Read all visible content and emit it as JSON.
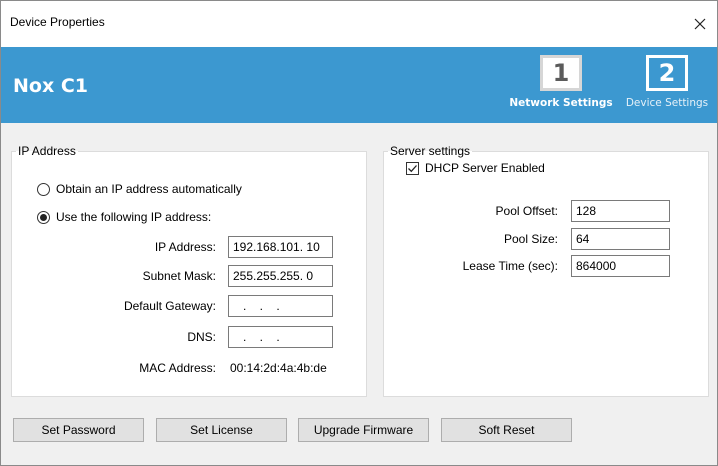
{
  "window": {
    "title": "Device Properties",
    "close_glyph": "×",
    "close_icon": "close-icon"
  },
  "banner": {
    "device_name": "Nox C1",
    "steps": [
      {
        "number": "1",
        "label": "Network Settings",
        "active": true
      },
      {
        "number": "2",
        "label": "Device Settings",
        "active": false
      }
    ],
    "colors": {
      "background": "#3c98d0",
      "text": "#ffffff"
    }
  },
  "ip_address": {
    "group_label": "IP Address",
    "radio_auto_label": "Obtain an IP address automatically",
    "radio_manual_label": "Use the following IP address:",
    "selected_option": "manual",
    "fields": {
      "ip_label": "IP Address:",
      "ip_value": "192.168.101. 10",
      "subnet_label": "Subnet Mask:",
      "subnet_value": "255.255.255. 0",
      "gateway_label": "Default Gateway:",
      "gateway_value": "   .    .    .",
      "dns_label": "DNS:",
      "dns_value": "   .    .    .",
      "mac_label": "MAC Address:",
      "mac_value": "00:14:2d:4a:4b:de"
    }
  },
  "server": {
    "group_label": "Server settings",
    "dhcp_label": "DHCP Server Enabled",
    "dhcp_checked": true,
    "pool_offset_label": "Pool Offset:",
    "pool_offset_value": "128",
    "pool_size_label": "Pool Size:",
    "pool_size_value": "64",
    "lease_time_label": "Lease Time (sec):",
    "lease_time_value": "864000"
  },
  "buttons": {
    "set_password": "Set Password",
    "set_license": "Set License",
    "upgrade_firmware": "Upgrade Firmware",
    "soft_reset": "Soft Reset"
  }
}
